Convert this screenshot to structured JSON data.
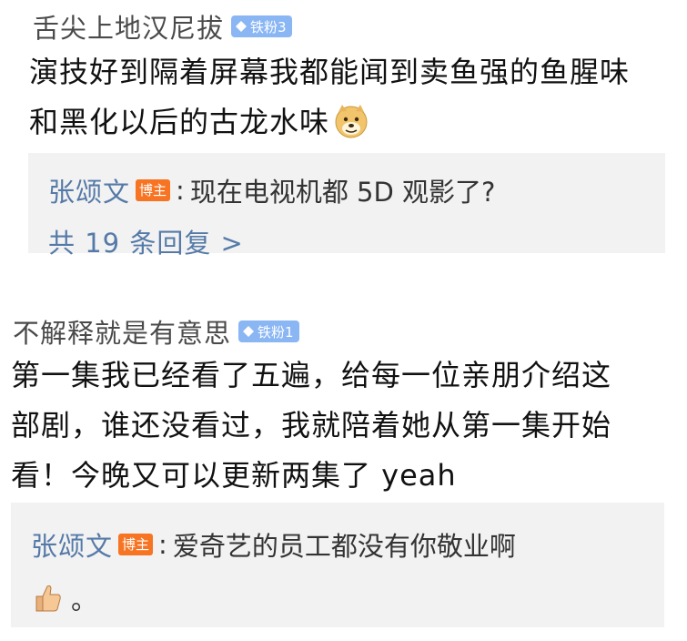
{
  "comments": [
    {
      "username": "舌尖上地汉尼拔",
      "badge": "铁粉3",
      "text_lines": [
        "演技好到隔着屏幕我都能闻到卖鱼强的鱼腥味",
        "和黑化以后的古龙水味"
      ],
      "emoji": "doge-icon",
      "reply": {
        "name": "张颂文",
        "tag": "博主",
        "colon": ":",
        "text": "现在电视机都 5D 观影了?"
      },
      "more_replies": "共 19 条回复 >"
    },
    {
      "username": "不解释就是有意思",
      "badge": "铁粉1",
      "text_lines": [
        "第一集我已经看了五遍，给每一位亲朋介绍这",
        "部剧，谁还没看过，我就陪着她从第一集开始",
        "看！今晚又可以更新两集了 yeah"
      ],
      "reply": {
        "name": "张颂文",
        "tag": "博主",
        "colon": ":",
        "text": "爱奇艺的员工都没有你敬业啊",
        "text2": "。",
        "emoji": "thumbs-up-icon"
      }
    }
  ],
  "colors": {
    "badge": "#8ab6f4",
    "host_tag": "#f77423",
    "reply_name": "#557aa8",
    "reply_bg": "#f2f2f2"
  }
}
